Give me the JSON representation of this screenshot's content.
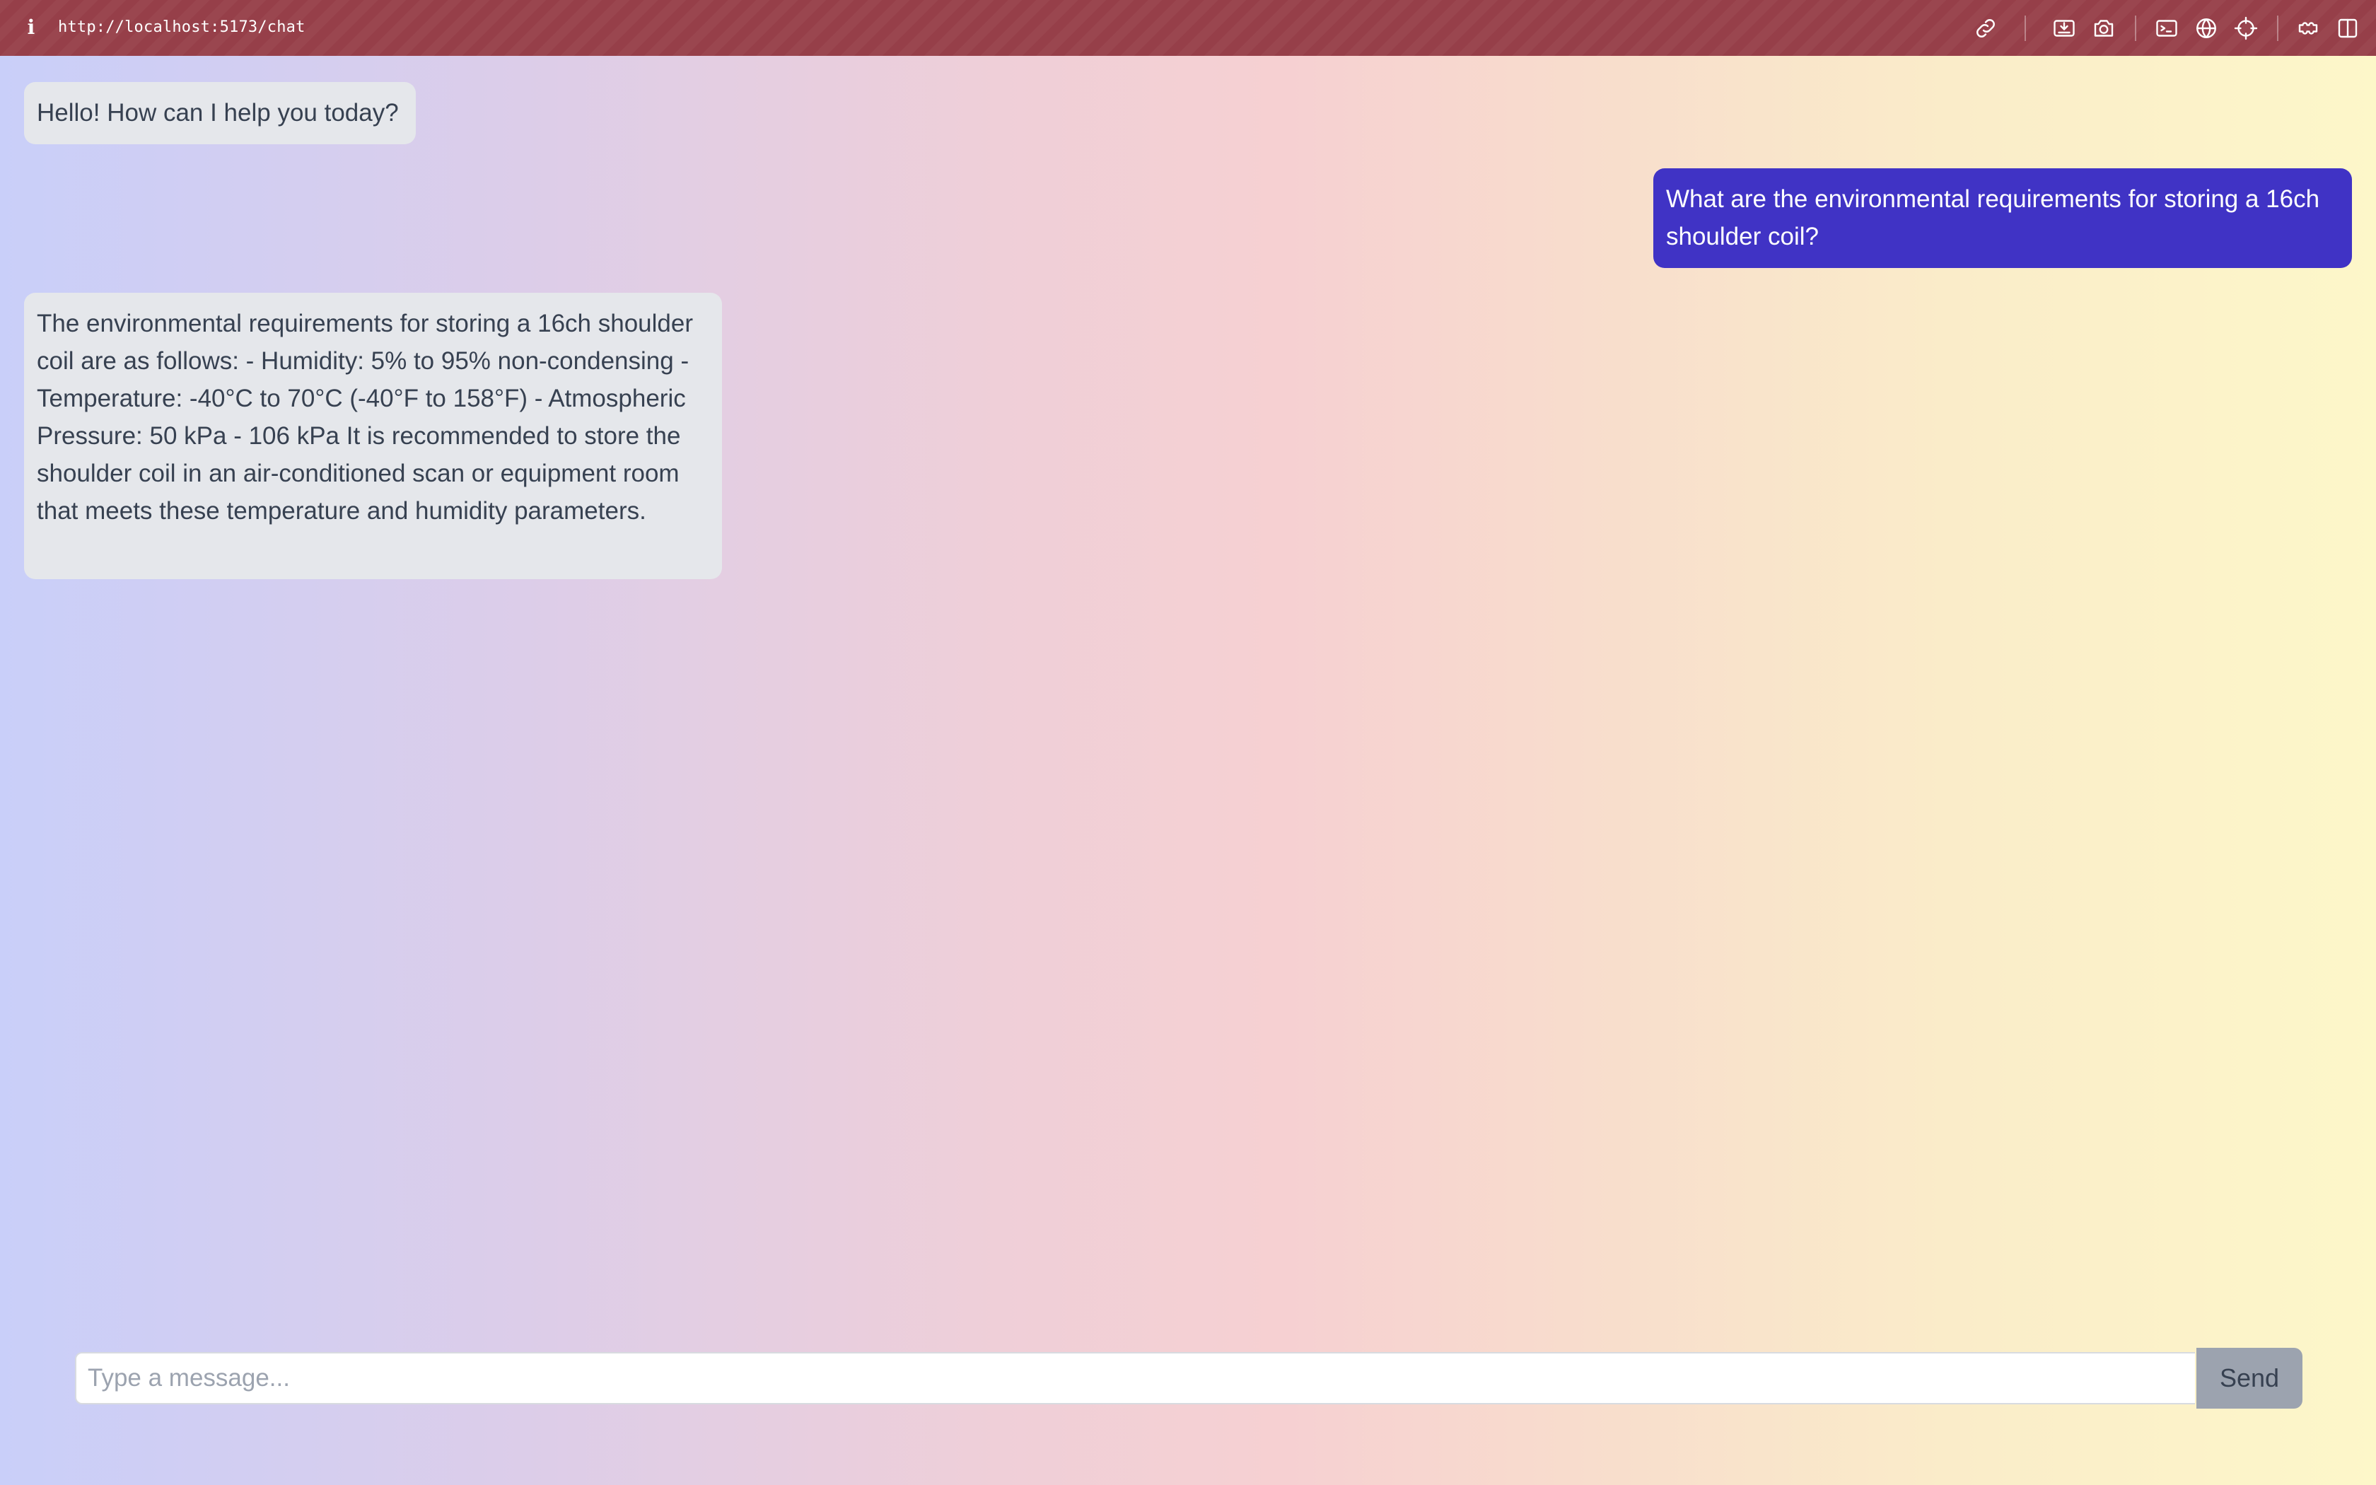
{
  "browser": {
    "info_glyph": "i",
    "url": "http://localhost:5173/chat",
    "toolbar_icons": [
      "link-icon",
      "screenshot-area-icon",
      "camera-icon",
      "terminal-icon",
      "globe-icon",
      "crosshair-icon",
      "extension-icon",
      "split-view-icon"
    ]
  },
  "chat": {
    "messages": [
      {
        "role": "assistant",
        "text": "Hello! How can I help you today?"
      },
      {
        "role": "user",
        "text": "What are the environmental requirements for storing a 16ch shoulder coil?"
      },
      {
        "role": "assistant",
        "text": "The environmental requirements for storing a 16ch shoulder coil are as follows: - Humidity: 5% to 95% non-condensing - Temperature: -40°C to 70°C (-40°F to 158°F) - Atmospheric Pressure: 50 kPa - 106 kPa It is recommended to store the shoulder coil in an air-conditioned scan or equipment room that meets these temperature and humidity parameters."
      }
    ]
  },
  "composer": {
    "placeholder": "Type a message...",
    "value": "",
    "send_label": "Send"
  },
  "colors": {
    "toolbar": "#963f49",
    "user_bubble": "#4033c5",
    "assistant_bubble": "#e5e7eb",
    "send_button": "#9ca3af"
  }
}
